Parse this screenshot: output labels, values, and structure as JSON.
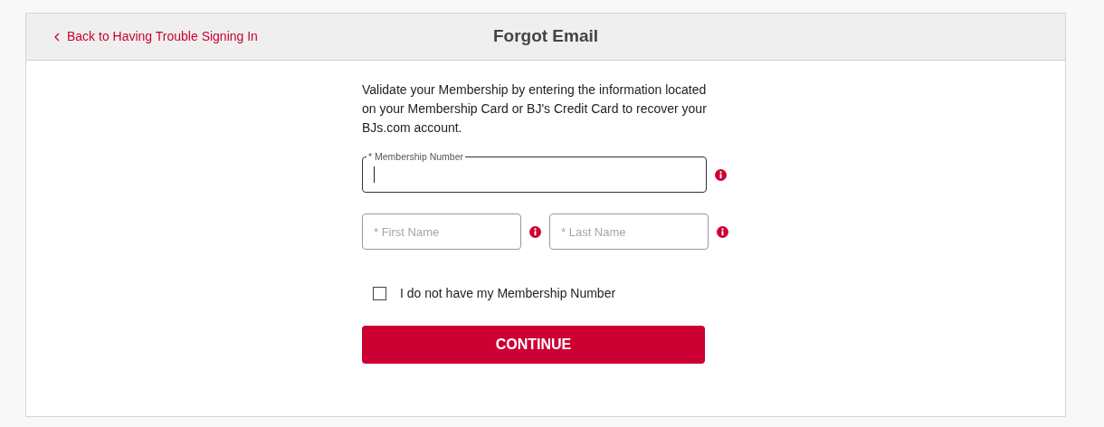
{
  "header": {
    "back_link": "Back to Having Trouble Signing In",
    "title": "Forgot Email"
  },
  "intro": "Validate your Membership by entering the information located on your Membership Card or BJ's Credit Card to recover your BJs.com account.",
  "membership_field": {
    "label": "* Membership Number",
    "focused": true
  },
  "first_name": {
    "placeholder": "* First Name"
  },
  "last_name": {
    "placeholder": "* Last Name"
  },
  "no_membership": {
    "label": "I do not have my Membership Number",
    "checked": false
  },
  "submit": "CONTINUE"
}
